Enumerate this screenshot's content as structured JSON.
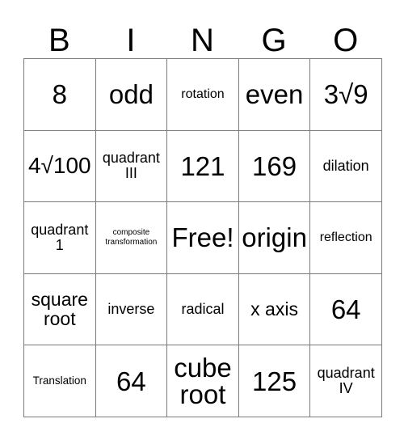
{
  "card": {
    "title": "BINGO",
    "header_letters": [
      "B",
      "I",
      "N",
      "G",
      "O"
    ],
    "free_space_label": "Free!",
    "border_color": "#7a7a7a",
    "text_color": "#000000",
    "background_color": "#ffffff",
    "rows": [
      [
        {
          "text": "8",
          "size": "xxl"
        },
        {
          "text": "odd",
          "size": "xxl"
        },
        {
          "text": "rotation",
          "size": "s"
        },
        {
          "text": "even",
          "size": "xxl"
        },
        {
          "text": "3√9",
          "size": "xxl"
        }
      ],
      [
        {
          "text": "4√100",
          "size": "xl"
        },
        {
          "text": "quadrant III",
          "size": "m"
        },
        {
          "text": "121",
          "size": "xxl"
        },
        {
          "text": "169",
          "size": "xxl"
        },
        {
          "text": "dilation",
          "size": "m"
        }
      ],
      [
        {
          "text": "quadrant 1",
          "size": "m"
        },
        {
          "text": "composite transformation",
          "size": "xxs"
        },
        {
          "text": "Free!",
          "size": "xxl"
        },
        {
          "text": "origin",
          "size": "xxl"
        },
        {
          "text": "reflection",
          "size": "s"
        }
      ],
      [
        {
          "text": "square root",
          "size": "l"
        },
        {
          "text": "inverse",
          "size": "m"
        },
        {
          "text": "radical",
          "size": "m"
        },
        {
          "text": "x axis",
          "size": "l"
        },
        {
          "text": "64",
          "size": "xxl"
        }
      ],
      [
        {
          "text": "Translation",
          "size": "xs"
        },
        {
          "text": "64",
          "size": "xxl"
        },
        {
          "text": "cube root",
          "size": "xxl"
        },
        {
          "text": "125",
          "size": "xxl"
        },
        {
          "text": "quadrant IV",
          "size": "m"
        }
      ]
    ]
  }
}
